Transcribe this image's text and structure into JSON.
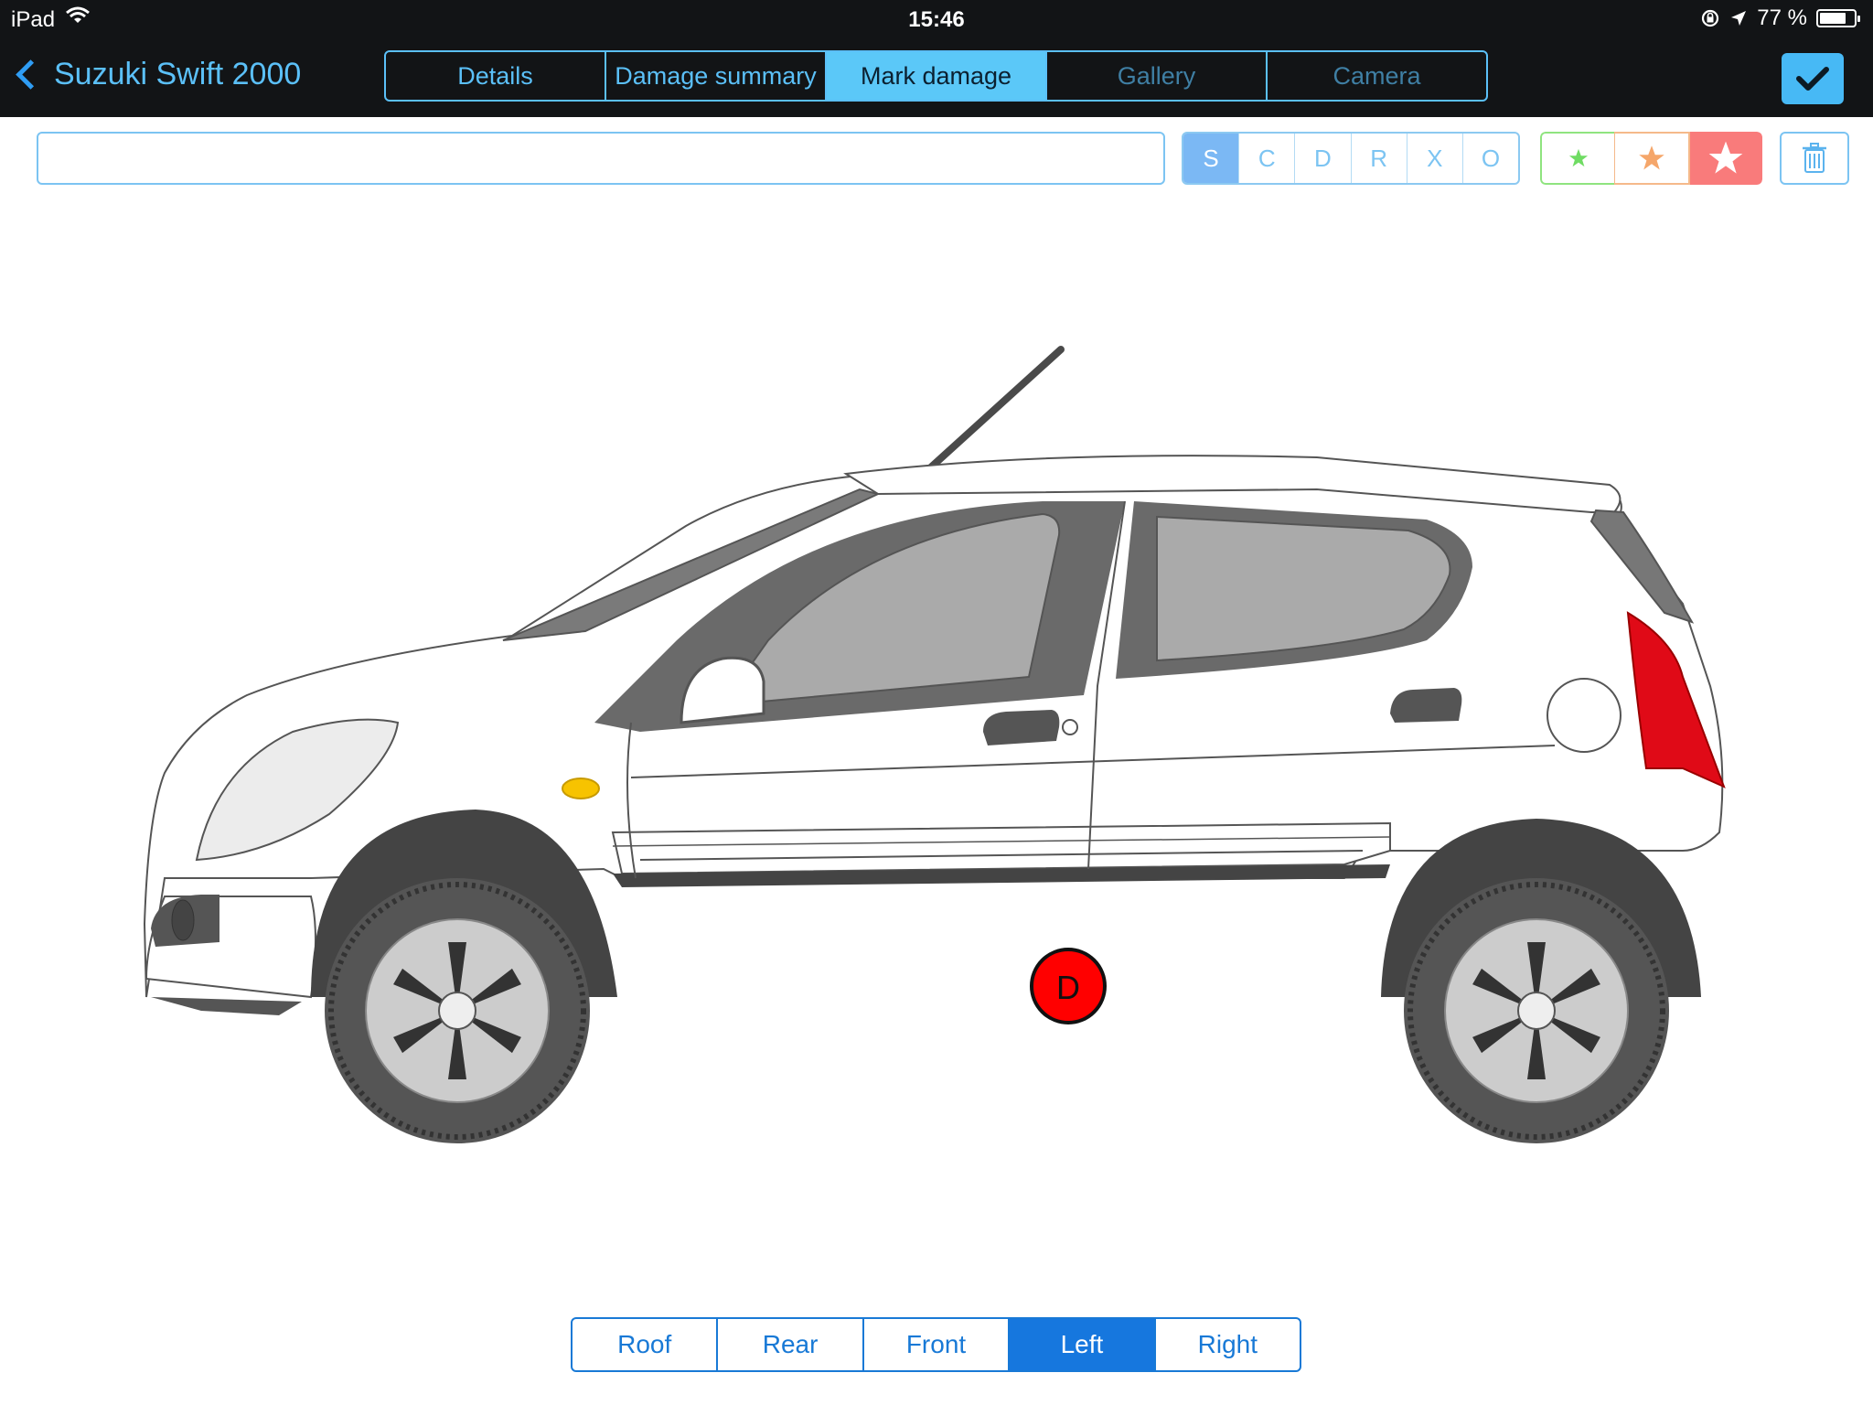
{
  "status_bar": {
    "carrier": "iPad",
    "time": "15:46",
    "battery": "77 %",
    "battery_level": 0.77
  },
  "nav": {
    "back_title": "Suzuki Swift 2000",
    "tabs": [
      {
        "label": "Details",
        "state": "normal"
      },
      {
        "label": "Damage summary",
        "state": "normal"
      },
      {
        "label": "Mark damage",
        "state": "active"
      },
      {
        "label": "Gallery",
        "state": "disabled"
      },
      {
        "label": "Camera",
        "state": "disabled"
      }
    ]
  },
  "toolbar": {
    "note_value": "",
    "codes": [
      "S",
      "C",
      "D",
      "R",
      "X",
      "O"
    ],
    "selected_code": "S",
    "severity": [
      {
        "icon": "small-star-icon",
        "color": "#6fdc63"
      },
      {
        "icon": "medium-star-icon",
        "color": "#f5a66a"
      },
      {
        "icon": "large-star-icon",
        "color": "#ffffff",
        "selected": true
      }
    ]
  },
  "damage_marker": {
    "code": "D",
    "color": "#ff0000"
  },
  "views": [
    "Roof",
    "Rear",
    "Front",
    "Left",
    "Right"
  ],
  "selected_view": "Left",
  "colors": {
    "accent": "#5bc0f8",
    "view_active": "#1677de",
    "tail_light": "#e00a17",
    "indicator": "#f7c300"
  }
}
